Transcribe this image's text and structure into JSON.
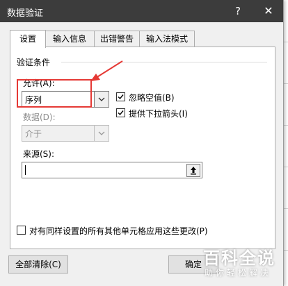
{
  "dialog": {
    "title": "数据验证",
    "help_symbol": "?",
    "close_symbol": "✕"
  },
  "tabs": [
    {
      "label": "设置",
      "active": true
    },
    {
      "label": "输入信息",
      "active": false
    },
    {
      "label": "出错警告",
      "active": false
    },
    {
      "label": "输入法模式",
      "active": false
    }
  ],
  "settings": {
    "group_label": "验证条件",
    "allow_label": "允许(A):",
    "allow_value": "序列",
    "ignore_blank_label": "忽略空值(B)",
    "ignore_blank_checked": true,
    "dropdown_label": "提供下拉箭头(I)",
    "dropdown_checked": true,
    "data_label": "数据(D):",
    "data_value": "介于",
    "source_label": "来源(S):",
    "source_value": "",
    "apply_all_label": "对有同样设置的所有其他单元格应用这些更改(P)",
    "apply_all_checked": false
  },
  "buttons": {
    "clear_all": "全部清除(C)",
    "ok": "确定"
  },
  "watermark": {
    "title": "百科全说",
    "subtitle": "助你轻松解决"
  },
  "colors": {
    "titlebar": "#3c3c3c",
    "highlight_red": "#e53935",
    "watermark_green": "#7cb342"
  }
}
